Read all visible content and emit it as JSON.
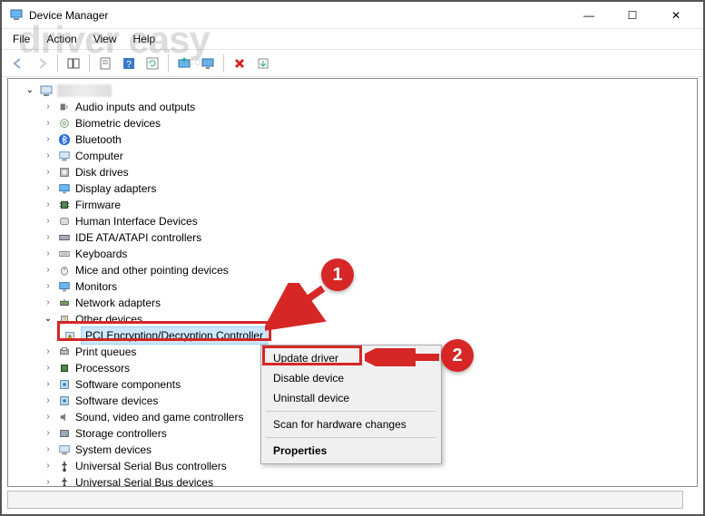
{
  "window": {
    "title": "Device Manager",
    "controls": {
      "minimize": "—",
      "maximize": "☐",
      "close": "✕"
    }
  },
  "menubar": [
    "File",
    "Action",
    "View",
    "Help"
  ],
  "toolbar_icons": [
    "back-icon",
    "forward-icon",
    "up-icon",
    "show-hide-icon",
    "properties-icon",
    "help-icon",
    "refresh-icon",
    "update-icon",
    "monitor-icon",
    "uninstall-icon",
    "scan-icon"
  ],
  "tree": {
    "root_icon": "computer-icon",
    "categories": [
      {
        "icon": "audio-icon",
        "label": "Audio inputs and outputs",
        "exp": false
      },
      {
        "icon": "fingerprint-icon",
        "label": "Biometric devices",
        "exp": false
      },
      {
        "icon": "bluetooth-icon",
        "label": "Bluetooth",
        "exp": false
      },
      {
        "icon": "computer-icon",
        "label": "Computer",
        "exp": false
      },
      {
        "icon": "disk-icon",
        "label": "Disk drives",
        "exp": false
      },
      {
        "icon": "display-icon",
        "label": "Display adapters",
        "exp": false
      },
      {
        "icon": "chip-icon",
        "label": "Firmware",
        "exp": false
      },
      {
        "icon": "hid-icon",
        "label": "Human Interface Devices",
        "exp": false
      },
      {
        "icon": "ide-icon",
        "label": "IDE ATA/ATAPI controllers",
        "exp": false
      },
      {
        "icon": "keyboard-icon",
        "label": "Keyboards",
        "exp": false
      },
      {
        "icon": "mouse-icon",
        "label": "Mice and other pointing devices",
        "exp": false
      },
      {
        "icon": "monitor-icon",
        "label": "Monitors",
        "exp": false
      },
      {
        "icon": "network-icon",
        "label": "Network adapters",
        "exp": false
      },
      {
        "icon": "other-icon",
        "label": "Other devices",
        "exp": true,
        "children": [
          {
            "icon": "warning-icon",
            "label": "PCI Encryption/Decryption Controller",
            "selected": true
          }
        ]
      },
      {
        "icon": "printer-icon",
        "label": "Print queues",
        "exp": false
      },
      {
        "icon": "processor-icon",
        "label": "Processors",
        "exp": false
      },
      {
        "icon": "software-icon",
        "label": "Software components",
        "exp": false
      },
      {
        "icon": "software-icon",
        "label": "Software devices",
        "exp": false
      },
      {
        "icon": "sound-icon",
        "label": "Sound, video and game controllers",
        "exp": false
      },
      {
        "icon": "storage-icon",
        "label": "Storage controllers",
        "exp": false
      },
      {
        "icon": "system-icon",
        "label": "System devices",
        "exp": false
      },
      {
        "icon": "usb-icon",
        "label": "Universal Serial Bus controllers",
        "exp": false
      },
      {
        "icon": "usb-icon",
        "label": "Universal Serial Bus devices",
        "exp": false
      }
    ]
  },
  "context_menu": {
    "items": [
      {
        "label": "Update driver",
        "highlight": true
      },
      {
        "label": "Disable device"
      },
      {
        "label": "Uninstall device"
      },
      {
        "sep": true
      },
      {
        "label": "Scan for hardware changes"
      },
      {
        "sep": true
      },
      {
        "label": "Properties",
        "em": true
      }
    ]
  },
  "annotations": {
    "bubble1": "1",
    "bubble2": "2"
  },
  "watermark": {
    "main": "driver easy",
    "sub": ".com"
  },
  "colors": {
    "highlight": "#d62626",
    "selection": "#cce8ff"
  }
}
